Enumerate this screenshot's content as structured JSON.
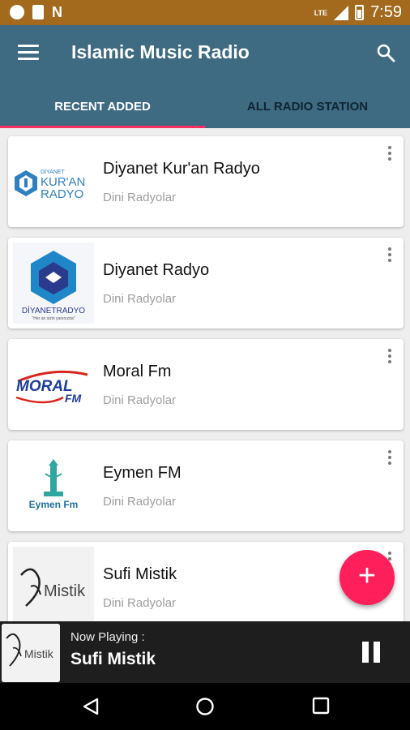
{
  "status_bar": {
    "network": "LTE",
    "time": "7:59",
    "icons": [
      "circle-icon",
      "sd-card-icon",
      "n-icon",
      "signal-icon",
      "battery-icon"
    ]
  },
  "app_bar": {
    "title": "Islamic Music Radio",
    "tabs": [
      {
        "label": "RECENT ADDED",
        "active": true
      },
      {
        "label": "ALL RADIO STATION",
        "active": false
      }
    ]
  },
  "stations": [
    {
      "name": "Diyanet Kur'an Radyo",
      "category": "Dini Radyolar",
      "logo_text": [
        "DİYANET",
        "KUR'AN",
        "RADYO"
      ]
    },
    {
      "name": "Diyanet Radyo",
      "category": "Dini Radyolar",
      "logo_text": [
        "DİYANETRADYO",
        "\"Her an sizin yanınızda\""
      ]
    },
    {
      "name": "Moral Fm",
      "category": "Dini Radyolar",
      "logo_text": [
        "MORAL",
        "FM"
      ]
    },
    {
      "name": "Eymen FM",
      "category": "Dini Radyolar",
      "logo_text": [
        "Eymen Fm"
      ]
    },
    {
      "name": "Sufi Mistik",
      "category": "Dini Radyolar",
      "logo_text": [
        "Mistik"
      ]
    }
  ],
  "now_playing": {
    "label": "Now Playing :",
    "title": "Sufi Mistik",
    "logo_text": "Mistik"
  },
  "colors": {
    "status_bar": "#a36a1e",
    "app_bar": "#3e6a82",
    "accent": "#ff1f5a",
    "player": "#1e1e1e"
  }
}
